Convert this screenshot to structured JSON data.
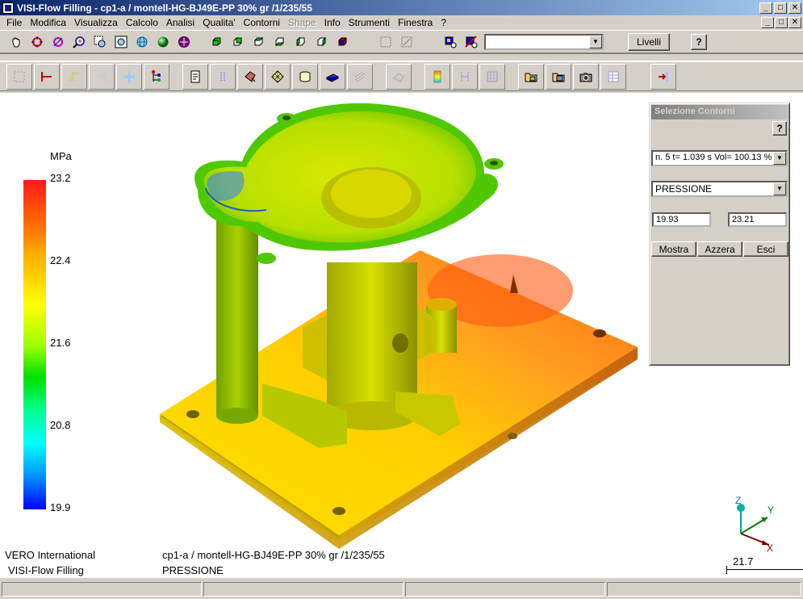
{
  "window": {
    "title": "VISI-Flow Filling - cp1-a / montell-HG-BJ49E-PP 30% gr /1/235/55",
    "minimize": "_",
    "maximize": "□",
    "close": "✕"
  },
  "menu": [
    {
      "label": "File",
      "disabled": false
    },
    {
      "label": "Modifica",
      "disabled": false
    },
    {
      "label": "Visualizza",
      "disabled": false
    },
    {
      "label": "Calcolo",
      "disabled": false
    },
    {
      "label": "Analisi",
      "disabled": false
    },
    {
      "label": "Qualita'",
      "disabled": false
    },
    {
      "label": "Contorni",
      "disabled": false
    },
    {
      "label": "Shape",
      "disabled": true
    },
    {
      "label": "Info",
      "disabled": false
    },
    {
      "label": "Strumenti",
      "disabled": false
    },
    {
      "label": "Finestra",
      "disabled": false
    },
    {
      "label": "?",
      "disabled": false
    }
  ],
  "toolbar": {
    "livelli_label": "Livelli",
    "help_label": "?",
    "layer_select_value": ""
  },
  "legend": {
    "unit": "MPa",
    "ticks": [
      "23.2",
      "22.4",
      "21.6",
      "20.8",
      "19.9"
    ]
  },
  "info": {
    "company": "VERO International",
    "product": "VISI-Flow Filling",
    "model": "cp1-a / montell-HG-BJ49E-PP 30% gr /1/235/55",
    "result": "PRESSIONE"
  },
  "axes": {
    "z": "Z",
    "y": "Y",
    "x": "X",
    "scale": "21.7"
  },
  "dialog": {
    "title": "Selezione Contorni",
    "help": "?",
    "step_value": "n. 5  t= 1.039 s  Vol= 100.13 %",
    "result_value": "PRESSIONE",
    "min_value": "19.93",
    "max_value": "23.21",
    "show_label": "Mostra",
    "reset_label": "Azzera",
    "exit_label": "Esci"
  },
  "colors": {
    "titlebar": "#0a246a",
    "max": "#ff1a1a",
    "min": "#0000ff"
  }
}
